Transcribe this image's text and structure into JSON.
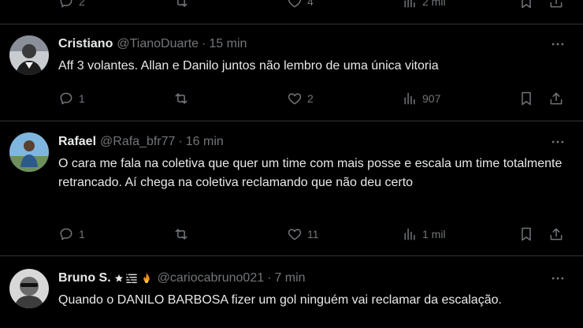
{
  "top_actions": {
    "reply": "2",
    "retweet": "",
    "like": "4",
    "views": "2 mil"
  },
  "tweets": [
    {
      "name": "Cristiano",
      "handle": "@TianoDuarte",
      "separator": "·",
      "time": "15 min",
      "text": "Aff 3 volantes. Allan e Danilo juntos não lembro de uma única vitoria",
      "replies": "1",
      "retweets": "",
      "likes": "2",
      "views": "907"
    },
    {
      "name": "Rafael",
      "handle": "@Rafa_bfr77",
      "separator": "·",
      "time": "16 min",
      "text": "O cara me fala na coletiva que quer um time com mais posse e escala um time totalmente retrancado. Aí chega na coletiva reclamando que não deu certo",
      "replies": "1",
      "retweets": "",
      "likes": "11",
      "views": "1 mil"
    },
    {
      "name": "Bruno S.",
      "handle": "@cariocabruno021",
      "separator": "·",
      "time": "7 min",
      "text": "Quando o DANILO BARBOSA fizer um gol ninguém vai reclamar da escalação."
    }
  ],
  "icons": {
    "reply": "reply-icon",
    "retweet": "retweet-icon",
    "like": "heart-icon",
    "views": "views-chart-icon",
    "bookmark": "bookmark-icon",
    "share": "share-icon",
    "more": "more-dots-icon"
  },
  "colors": {
    "background": "#000000",
    "text": "#e7e9ea",
    "muted": "#71767b",
    "divider": "#2f3336"
  }
}
